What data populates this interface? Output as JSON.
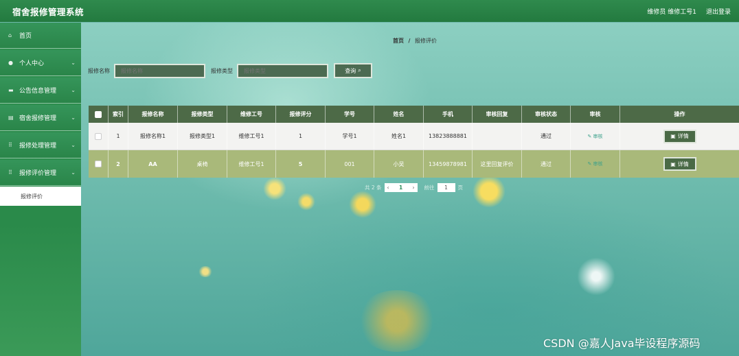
{
  "header": {
    "app_title": "宿舍报修管理系统",
    "user": "维修员 维修工号1",
    "logout": "退出登录"
  },
  "sidebar": {
    "items": [
      {
        "label": "首页",
        "icon": "home-icon",
        "has_chevron": false
      },
      {
        "label": "个人中心",
        "icon": "user-icon",
        "has_chevron": true
      },
      {
        "label": "公告信息管理",
        "icon": "message-icon",
        "has_chevron": true
      },
      {
        "label": "宿舍报修管理",
        "icon": "list-icon",
        "has_chevron": true
      },
      {
        "label": "报修处理管理",
        "icon": "grid-icon",
        "has_chevron": true
      },
      {
        "label": "报修评价管理",
        "icon": "grid-icon",
        "has_chevron": true
      }
    ],
    "submenu": {
      "label": "报修评价"
    }
  },
  "breadcrumb": {
    "home": "首页",
    "separator": "/",
    "current": "报修评价"
  },
  "search": {
    "name_label": "报修名称",
    "name_placeholder": "报修名称",
    "type_label": "报修类型",
    "type_placeholder": "报修类型",
    "button": "查询"
  },
  "table": {
    "headers": [
      "索引",
      "报修名称",
      "报修类型",
      "维修工号",
      "报修评分",
      "学号",
      "姓名",
      "手机",
      "审核回复",
      "审核状态",
      "审核",
      "操作"
    ],
    "rows": [
      {
        "index": "1",
        "name": "报修名称1",
        "type": "报修类型1",
        "worker": "维修工号1",
        "score": "1",
        "student_id": "学号1",
        "student_name": "姓名1",
        "phone": "13823888881",
        "reply": "",
        "status": "通过",
        "review": "审核",
        "action": "详情"
      },
      {
        "index": "2",
        "name": "AA",
        "type": "桌椅",
        "worker": "维修工号1",
        "score": "5",
        "student_id": "001",
        "student_name": "小吴",
        "phone": "13459878981",
        "reply": "这里回复评价",
        "status": "通过",
        "review": "审核",
        "action": "详情"
      }
    ]
  },
  "pagination": {
    "total": "共 2 条",
    "current_page": "1",
    "goto_label": "前往",
    "goto_value": "1",
    "page_suffix": "页"
  },
  "watermark": "CSDN @嘉人Java毕设程序源码",
  "colors": {
    "primary": "#2a8a4a",
    "table_header": "#4d6a47",
    "row_alt": "#a9b97a"
  }
}
